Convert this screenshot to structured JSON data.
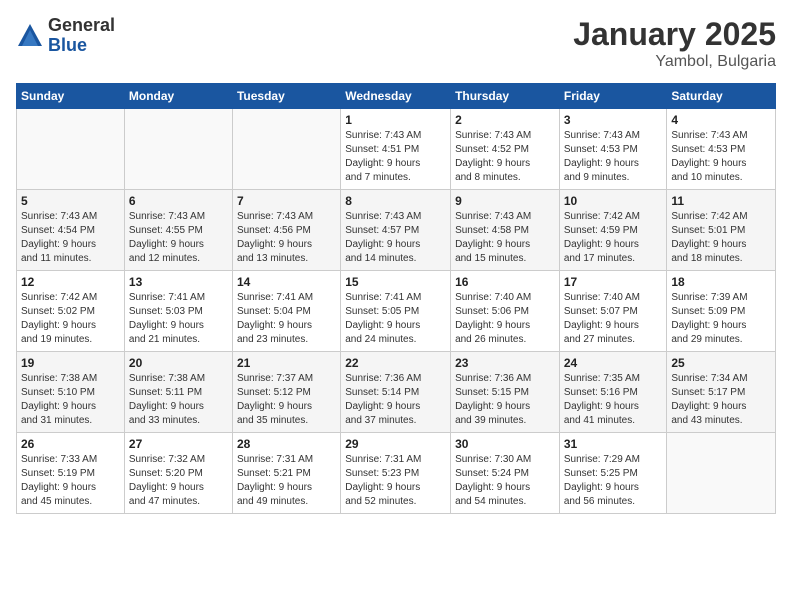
{
  "logo": {
    "general": "General",
    "blue": "Blue"
  },
  "title": "January 2025",
  "location": "Yambol, Bulgaria",
  "days_header": [
    "Sunday",
    "Monday",
    "Tuesday",
    "Wednesday",
    "Thursday",
    "Friday",
    "Saturday"
  ],
  "weeks": [
    [
      {
        "num": "",
        "info": ""
      },
      {
        "num": "",
        "info": ""
      },
      {
        "num": "",
        "info": ""
      },
      {
        "num": "1",
        "info": "Sunrise: 7:43 AM\nSunset: 4:51 PM\nDaylight: 9 hours\nand 7 minutes."
      },
      {
        "num": "2",
        "info": "Sunrise: 7:43 AM\nSunset: 4:52 PM\nDaylight: 9 hours\nand 8 minutes."
      },
      {
        "num": "3",
        "info": "Sunrise: 7:43 AM\nSunset: 4:53 PM\nDaylight: 9 hours\nand 9 minutes."
      },
      {
        "num": "4",
        "info": "Sunrise: 7:43 AM\nSunset: 4:53 PM\nDaylight: 9 hours\nand 10 minutes."
      }
    ],
    [
      {
        "num": "5",
        "info": "Sunrise: 7:43 AM\nSunset: 4:54 PM\nDaylight: 9 hours\nand 11 minutes."
      },
      {
        "num": "6",
        "info": "Sunrise: 7:43 AM\nSunset: 4:55 PM\nDaylight: 9 hours\nand 12 minutes."
      },
      {
        "num": "7",
        "info": "Sunrise: 7:43 AM\nSunset: 4:56 PM\nDaylight: 9 hours\nand 13 minutes."
      },
      {
        "num": "8",
        "info": "Sunrise: 7:43 AM\nSunset: 4:57 PM\nDaylight: 9 hours\nand 14 minutes."
      },
      {
        "num": "9",
        "info": "Sunrise: 7:43 AM\nSunset: 4:58 PM\nDaylight: 9 hours\nand 15 minutes."
      },
      {
        "num": "10",
        "info": "Sunrise: 7:42 AM\nSunset: 4:59 PM\nDaylight: 9 hours\nand 17 minutes."
      },
      {
        "num": "11",
        "info": "Sunrise: 7:42 AM\nSunset: 5:01 PM\nDaylight: 9 hours\nand 18 minutes."
      }
    ],
    [
      {
        "num": "12",
        "info": "Sunrise: 7:42 AM\nSunset: 5:02 PM\nDaylight: 9 hours\nand 19 minutes."
      },
      {
        "num": "13",
        "info": "Sunrise: 7:41 AM\nSunset: 5:03 PM\nDaylight: 9 hours\nand 21 minutes."
      },
      {
        "num": "14",
        "info": "Sunrise: 7:41 AM\nSunset: 5:04 PM\nDaylight: 9 hours\nand 23 minutes."
      },
      {
        "num": "15",
        "info": "Sunrise: 7:41 AM\nSunset: 5:05 PM\nDaylight: 9 hours\nand 24 minutes."
      },
      {
        "num": "16",
        "info": "Sunrise: 7:40 AM\nSunset: 5:06 PM\nDaylight: 9 hours\nand 26 minutes."
      },
      {
        "num": "17",
        "info": "Sunrise: 7:40 AM\nSunset: 5:07 PM\nDaylight: 9 hours\nand 27 minutes."
      },
      {
        "num": "18",
        "info": "Sunrise: 7:39 AM\nSunset: 5:09 PM\nDaylight: 9 hours\nand 29 minutes."
      }
    ],
    [
      {
        "num": "19",
        "info": "Sunrise: 7:38 AM\nSunset: 5:10 PM\nDaylight: 9 hours\nand 31 minutes."
      },
      {
        "num": "20",
        "info": "Sunrise: 7:38 AM\nSunset: 5:11 PM\nDaylight: 9 hours\nand 33 minutes."
      },
      {
        "num": "21",
        "info": "Sunrise: 7:37 AM\nSunset: 5:12 PM\nDaylight: 9 hours\nand 35 minutes."
      },
      {
        "num": "22",
        "info": "Sunrise: 7:36 AM\nSunset: 5:14 PM\nDaylight: 9 hours\nand 37 minutes."
      },
      {
        "num": "23",
        "info": "Sunrise: 7:36 AM\nSunset: 5:15 PM\nDaylight: 9 hours\nand 39 minutes."
      },
      {
        "num": "24",
        "info": "Sunrise: 7:35 AM\nSunset: 5:16 PM\nDaylight: 9 hours\nand 41 minutes."
      },
      {
        "num": "25",
        "info": "Sunrise: 7:34 AM\nSunset: 5:17 PM\nDaylight: 9 hours\nand 43 minutes."
      }
    ],
    [
      {
        "num": "26",
        "info": "Sunrise: 7:33 AM\nSunset: 5:19 PM\nDaylight: 9 hours\nand 45 minutes."
      },
      {
        "num": "27",
        "info": "Sunrise: 7:32 AM\nSunset: 5:20 PM\nDaylight: 9 hours\nand 47 minutes."
      },
      {
        "num": "28",
        "info": "Sunrise: 7:31 AM\nSunset: 5:21 PM\nDaylight: 9 hours\nand 49 minutes."
      },
      {
        "num": "29",
        "info": "Sunrise: 7:31 AM\nSunset: 5:23 PM\nDaylight: 9 hours\nand 52 minutes."
      },
      {
        "num": "30",
        "info": "Sunrise: 7:30 AM\nSunset: 5:24 PM\nDaylight: 9 hours\nand 54 minutes."
      },
      {
        "num": "31",
        "info": "Sunrise: 7:29 AM\nSunset: 5:25 PM\nDaylight: 9 hours\nand 56 minutes."
      },
      {
        "num": "",
        "info": ""
      }
    ]
  ]
}
